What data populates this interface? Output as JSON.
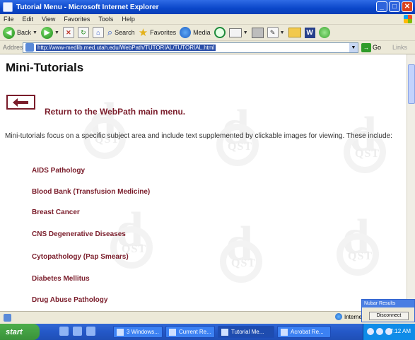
{
  "window": {
    "title": "Tutorial Menu - Microsoft Internet Explorer"
  },
  "menu": [
    "File",
    "Edit",
    "View",
    "Favorites",
    "Tools",
    "Help"
  ],
  "toolbar": {
    "back": "Back",
    "search": "Search",
    "favorites": "Favorites",
    "media": "Media"
  },
  "address": {
    "label": "Address",
    "url": "http://www-medlib.med.utah.edu/WebPath/TUTORIAL/TUTORIAL.html",
    "go": "Go",
    "links": "Links"
  },
  "page": {
    "heading": "Mini-Tutorials",
    "back_link": "Return to the WebPath main menu.",
    "intro": "Mini-tutorials focus on a specific subject area and include text supplemented by clickable images for viewing. These include:",
    "topics": [
      "AIDS Pathology",
      "Blood Bank (Transfusion Medicine)",
      "Breast Cancer",
      "CNS Degenerative Diseases",
      "Cytopathology (Pap Smears)",
      "Diabetes Mellitus",
      "Drug Abuse Pathology"
    ]
  },
  "status": {
    "zone": "Internet"
  },
  "popup": {
    "title": "Nubar Results",
    "button": "Disconnect"
  },
  "taskbar": {
    "start": "start",
    "tasks": [
      "3 Windows...",
      "Current Re...",
      "Tutorial Me...",
      "Acrobat Re..."
    ],
    "clock": "7:12 AM"
  }
}
